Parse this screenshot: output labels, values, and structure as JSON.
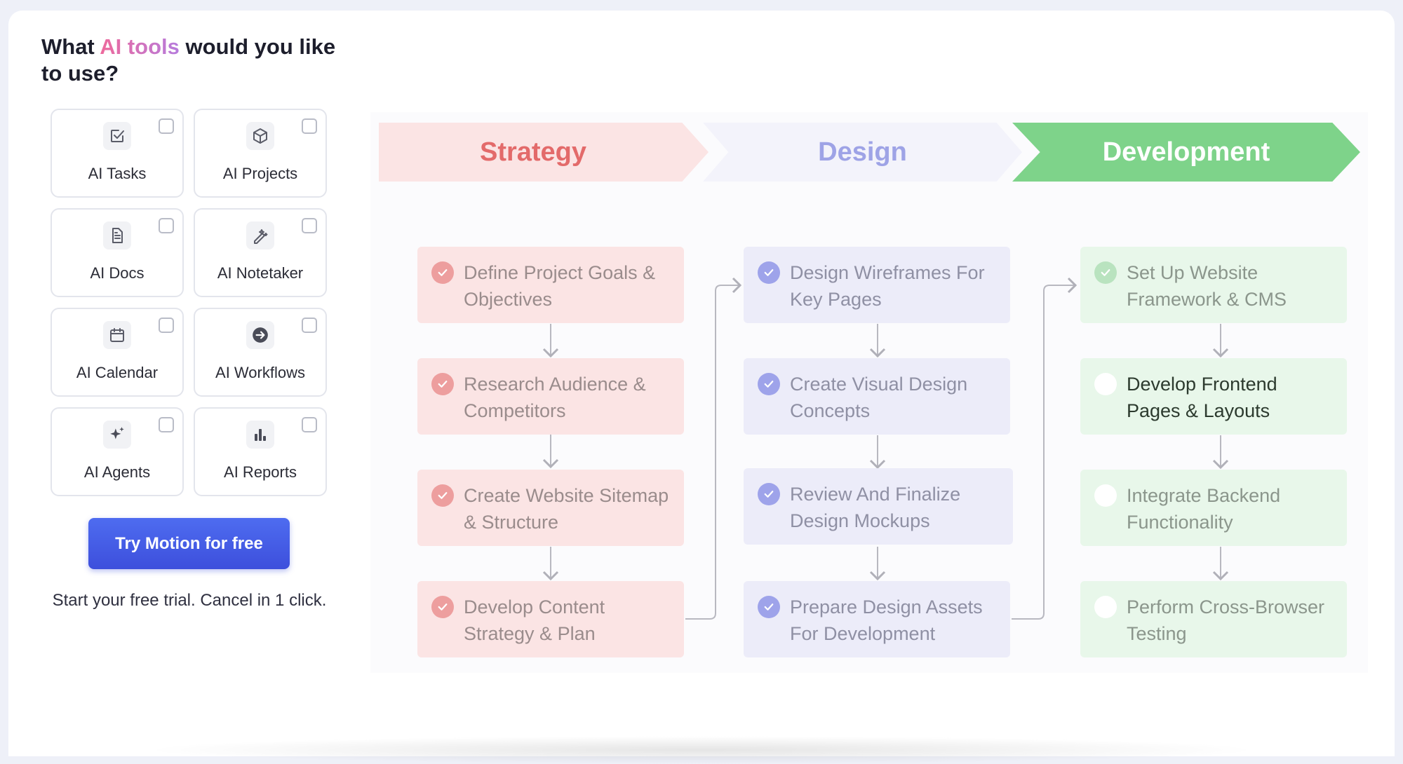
{
  "question": {
    "prefix": "What ",
    "accent": "AI tools",
    "suffix": " would you like to use?"
  },
  "tools": [
    {
      "label": "AI Tasks",
      "icon": "task-check-icon"
    },
    {
      "label": "AI Projects",
      "icon": "cube-icon"
    },
    {
      "label": "AI Docs",
      "icon": "document-icon"
    },
    {
      "label": "AI Notetaker",
      "icon": "magic-pen-icon"
    },
    {
      "label": "AI Calendar",
      "icon": "calendar-icon"
    },
    {
      "label": "AI Workflows",
      "icon": "arrow-circle-icon"
    },
    {
      "label": "AI Agents",
      "icon": "sparkles-icon"
    },
    {
      "label": "AI Reports",
      "icon": "bar-chart-icon"
    }
  ],
  "cta": {
    "label": "Try Motion for free",
    "subtext": "Start your free trial. Cancel in 1 click."
  },
  "phases": [
    {
      "label": "Strategy",
      "color": "#e36a6a"
    },
    {
      "label": "Design",
      "color": "#9ea3e6"
    },
    {
      "label": "Development",
      "color": "#ffffff"
    }
  ],
  "tasks": {
    "strategy": [
      {
        "label": "Define Project Goals & Objectives",
        "done": true
      },
      {
        "label": "Research Audience & Competitors",
        "done": true
      },
      {
        "label": "Create Website Sitemap & Structure",
        "done": true
      },
      {
        "label": "Develop Content Strategy & Plan",
        "done": true
      }
    ],
    "design": [
      {
        "label": "Design Wireframes For Key Pages",
        "done": true
      },
      {
        "label": "Create Visual Design Concepts",
        "done": true
      },
      {
        "label": "Review And Finalize Design Mockups",
        "done": true
      },
      {
        "label": "Prepare Design Assets For Development",
        "done": true
      }
    ],
    "development": [
      {
        "label": "Set Up Website Framework & CMS",
        "done": true
      },
      {
        "label": "Develop Frontend Pages & Layouts",
        "done": false
      },
      {
        "label": "Integrate Backend Functionality",
        "done": false
      },
      {
        "label": "Perform Cross-Browser Testing",
        "done": false
      }
    ]
  }
}
